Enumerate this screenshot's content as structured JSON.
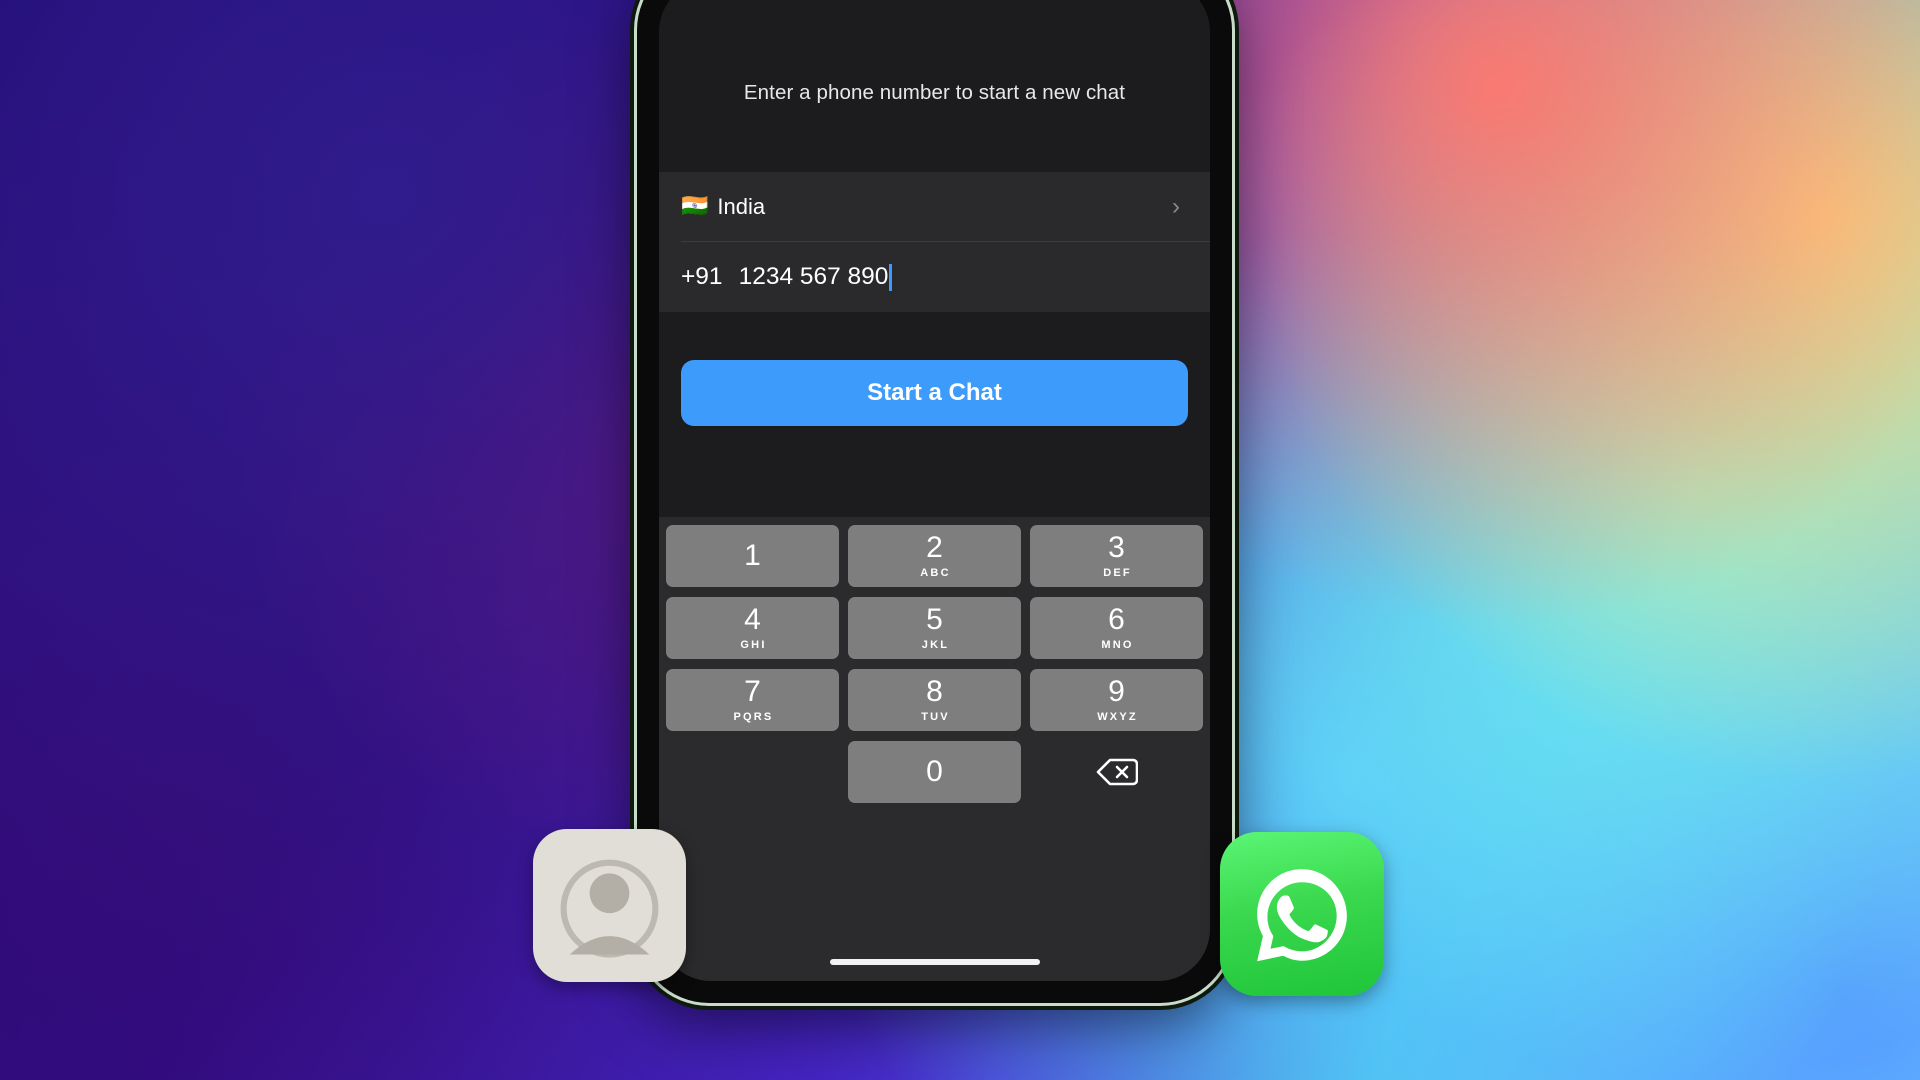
{
  "wallpaper": {
    "name": "gradient-wallpaper"
  },
  "phone": {
    "sheet": {
      "instruction": "Enter a phone number to start a new chat"
    },
    "country": {
      "flag": "🇮🇳",
      "name": "India",
      "chevron": "›"
    },
    "number_field": {
      "dial_code": "+91",
      "value": "1234 567 890",
      "placeholder": "phone number"
    },
    "actions": {
      "start_chat_label": "Start a Chat"
    },
    "keypad": {
      "rows": [
        [
          {
            "digit": "1",
            "letters": ""
          },
          {
            "digit": "2",
            "letters": "ABC"
          },
          {
            "digit": "3",
            "letters": "DEF"
          }
        ],
        [
          {
            "digit": "4",
            "letters": "GHI"
          },
          {
            "digit": "5",
            "letters": "JKL"
          },
          {
            "digit": "6",
            "letters": "MNO"
          }
        ],
        [
          {
            "digit": "7",
            "letters": "PQRS"
          },
          {
            "digit": "8",
            "letters": "TUV"
          },
          {
            "digit": "9",
            "letters": "WXYZ"
          }
        ],
        [
          {
            "digit": "",
            "letters": "",
            "blank": true
          },
          {
            "digit": "0",
            "letters": ""
          },
          {
            "digit": "",
            "letters": "",
            "backspace": true
          }
        ]
      ],
      "backspace_icon": "backspace-delete-icon"
    }
  },
  "dock": {
    "contacts_icon": "contacts-person-icon",
    "whatsapp_icon": "whatsapp-logo-icon"
  },
  "colors": {
    "accent_blue": "#3d9bfc",
    "key_gray": "#7e7e7e",
    "sheet_dark": "#1c1c1e",
    "row_dark": "#2a2a2c",
    "whatsapp_green": "#25D366"
  }
}
